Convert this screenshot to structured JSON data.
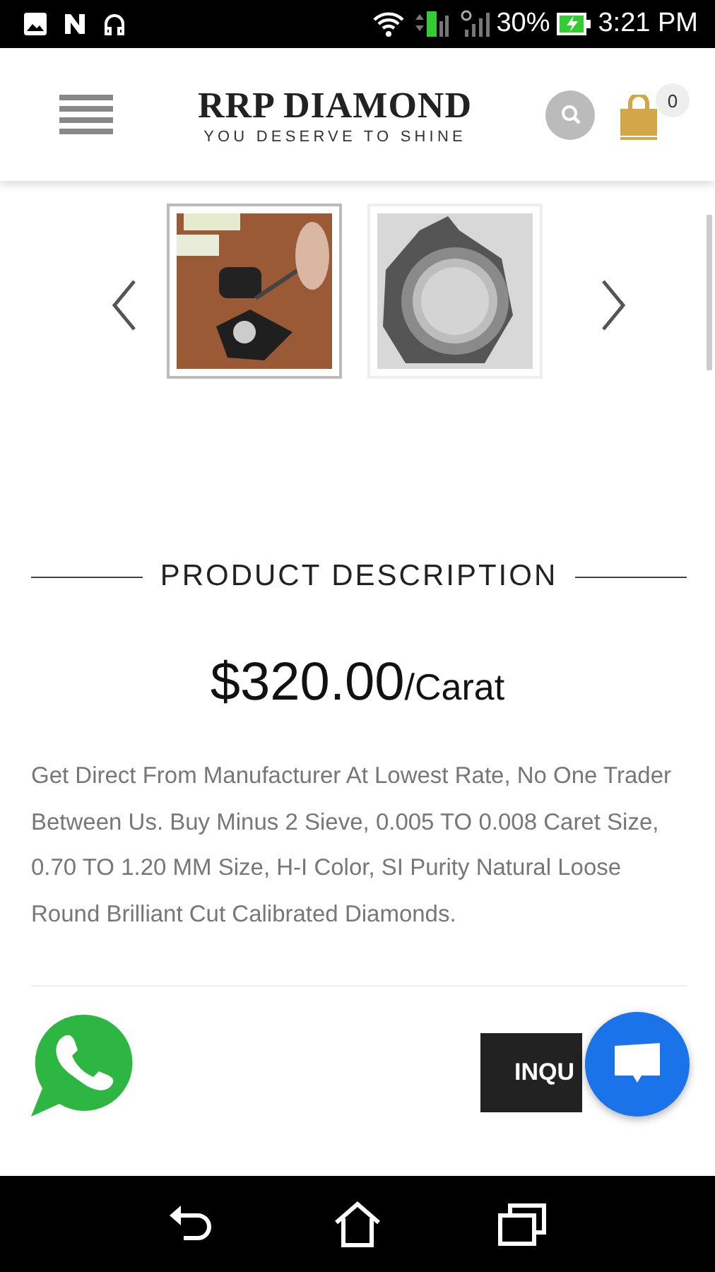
{
  "status_bar": {
    "battery": "30%",
    "time": "3:21 PM"
  },
  "header": {
    "brand": "RRP DIAMOND",
    "tagline": "YOU DESERVE TO SHINE",
    "cart_count": "0"
  },
  "gallery": {
    "thumbnails": [
      {
        "kind": "picture",
        "selected": true
      },
      {
        "kind": "picture",
        "selected": false
      }
    ]
  },
  "section_title": "PRODUCT DESCRIPTION",
  "price": {
    "amount": "$320.00",
    "unit": "/Carat"
  },
  "description": "Get Direct From Manufacturer At Lowest Rate, No One Trader Between Us. Buy Minus 2 Sieve, 0.005 TO 0.008 Caret Size, 0.70 TO 1.20 MM Size, H-I Color, SI Purity Natural Loose Round Brilliant Cut Calibrated Diamonds.",
  "inquiry_button": "INQU"
}
